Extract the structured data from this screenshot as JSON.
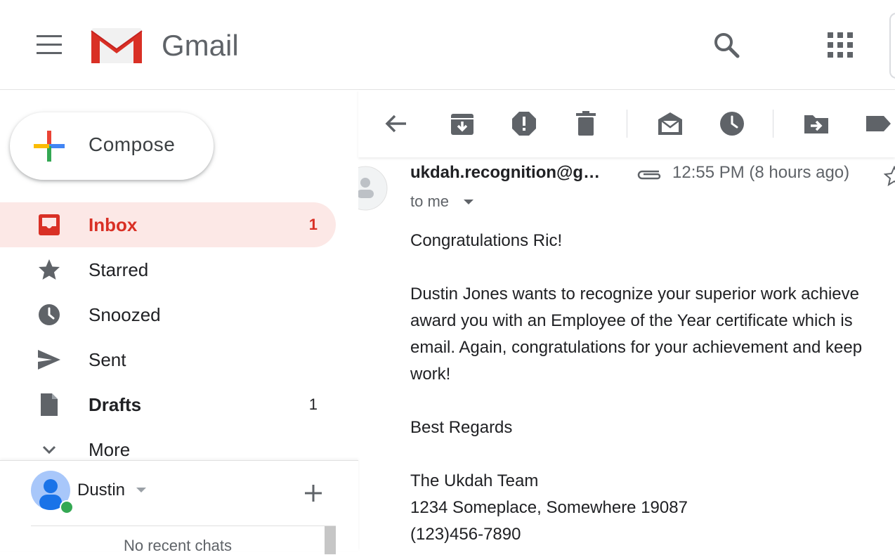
{
  "header": {
    "app_title": "Gmail"
  },
  "compose": {
    "label": "Compose"
  },
  "nav": {
    "items": [
      {
        "label": "Inbox",
        "count": "1",
        "icon": "inbox-icon"
      },
      {
        "label": "Starred",
        "count": "",
        "icon": "star-icon"
      },
      {
        "label": "Snoozed",
        "count": "",
        "icon": "clock-icon"
      },
      {
        "label": "Sent",
        "count": "",
        "icon": "send-icon"
      },
      {
        "label": "Drafts",
        "count": "1",
        "icon": "draft-icon"
      },
      {
        "label": "More",
        "count": "",
        "icon": "chevron-down-icon"
      }
    ]
  },
  "hangouts": {
    "user_name": "Dustin",
    "no_chats": "No recent chats"
  },
  "message": {
    "sender": "ukdah.recognition@g…",
    "time": "12:55 PM (8 hours ago)",
    "to": "to me",
    "greeting": "Congratulations Ric!",
    "paragraph_lines": [
      "Dustin Jones wants to recognize your superior work achieve",
      "award you with an Employee of the Year certificate which is",
      "email. Again, congratulations for your achievement and keep",
      "work!"
    ],
    "closing": "Best Regards",
    "signature_lines": [
      "The Ukdah Team",
      "1234 Someplace, Somewhere 19087",
      "(123)456-7890"
    ]
  },
  "colors": {
    "accent_red": "#d93025",
    "inbox_highlight": "#fce8e6",
    "icon_gray": "#5f6368",
    "online_green": "#34a853"
  }
}
